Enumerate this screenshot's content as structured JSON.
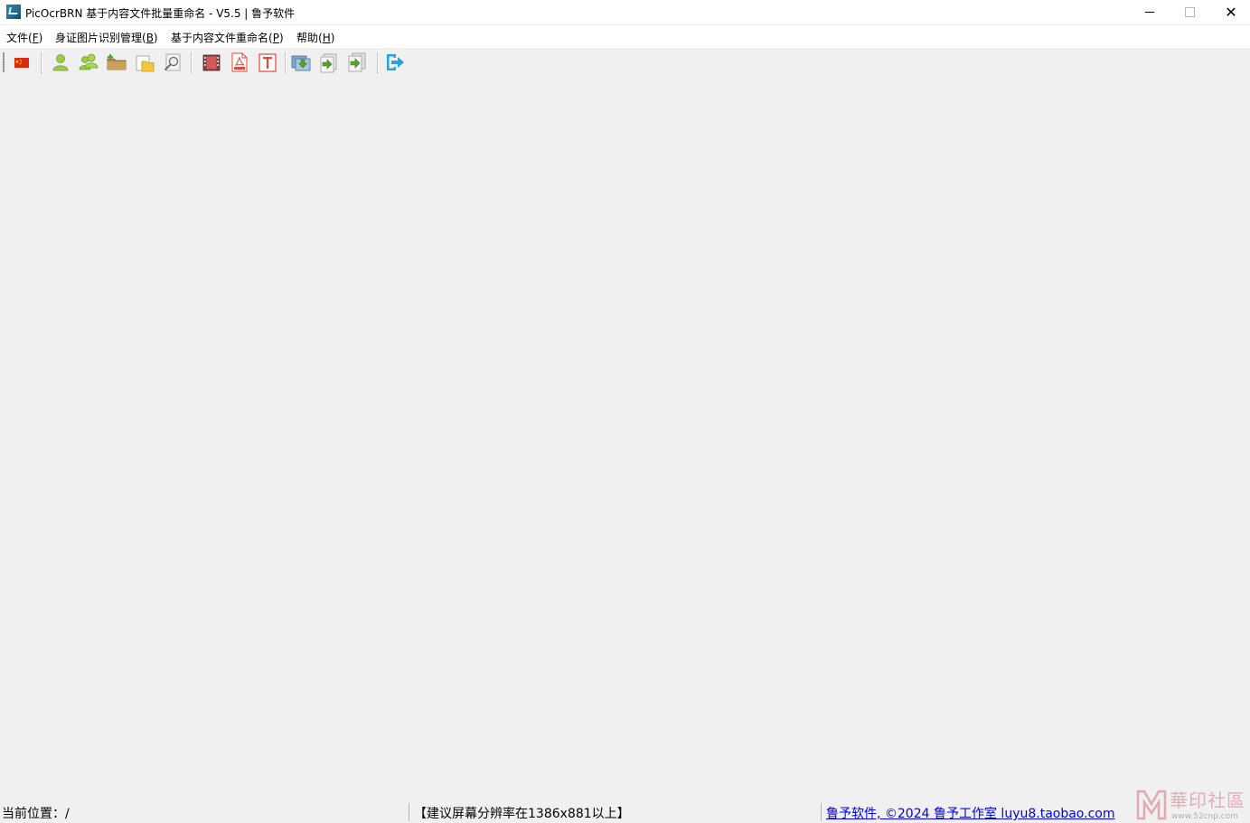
{
  "window": {
    "title": "PicOcrBRN 基于内容文件批量重命名 - V5.5   | 鲁予软件",
    "controls": {
      "minimize": "—",
      "maximize": "□",
      "close": "✕"
    }
  },
  "menu": [
    {
      "label": "文件(",
      "key": "F",
      "tail": ")"
    },
    {
      "label": "身证图片识别管理(",
      "key": "B",
      "tail": ")"
    },
    {
      "label": "基于内容文件重命名(",
      "key": "P",
      "tail": ")"
    },
    {
      "label": "帮助(",
      "key": "H",
      "tail": ")"
    }
  ],
  "toolbar": {
    "icons": [
      "china-flag-icon",
      "user-icon",
      "users-icon",
      "add-folder-icon",
      "open-folder-icon",
      "search-document-icon",
      "film-icon",
      "pdf-icon",
      "text-file-icon",
      "import-images-icon",
      "export-right-icon",
      "export-batch-icon",
      "exit-icon"
    ]
  },
  "status": {
    "location_label": "当前位置：/",
    "hint": "【建议屏幕分辨率在1386x881以上】",
    "copyright_link": "鲁予软件, ©2024 鲁予工作室 luyu8.taobao.com"
  },
  "watermark": {
    "text": "華印社區",
    "url": "www.52cnp.com"
  },
  "colors": {
    "accent_green": "#8cc63e",
    "pdf_red": "#e0463c",
    "link_blue": "#0000ee",
    "arrow_blue": "#2aa3dc"
  }
}
